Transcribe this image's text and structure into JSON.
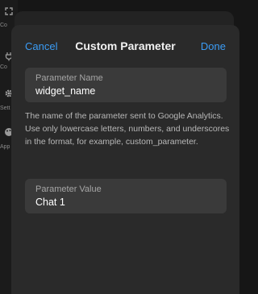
{
  "background": {
    "sidebar_items": [
      {
        "icon": "expand-icon",
        "label": "Co"
      },
      {
        "icon": "plug-icon",
        "label": "Co"
      },
      {
        "icon": "gear-icon",
        "label": "Sett"
      },
      {
        "icon": "palette-icon",
        "label": "App"
      }
    ]
  },
  "nav": {
    "cancel_label": "Cancel",
    "title": "Custom Parameter",
    "done_label": "Done"
  },
  "parameter_name": {
    "label": "Parameter Name",
    "value": "widget_name"
  },
  "help_text": "The name of the parameter sent to Google Analytics. Use only lowercase letters, numbers, and underscores in the format, for example, custom_parameter.",
  "parameter_value": {
    "label": "Parameter Value",
    "value": "Chat 1"
  },
  "colors": {
    "accent": "#3b9cf5",
    "sheet": "#2a2a2a",
    "field": "#3a3a3a"
  }
}
